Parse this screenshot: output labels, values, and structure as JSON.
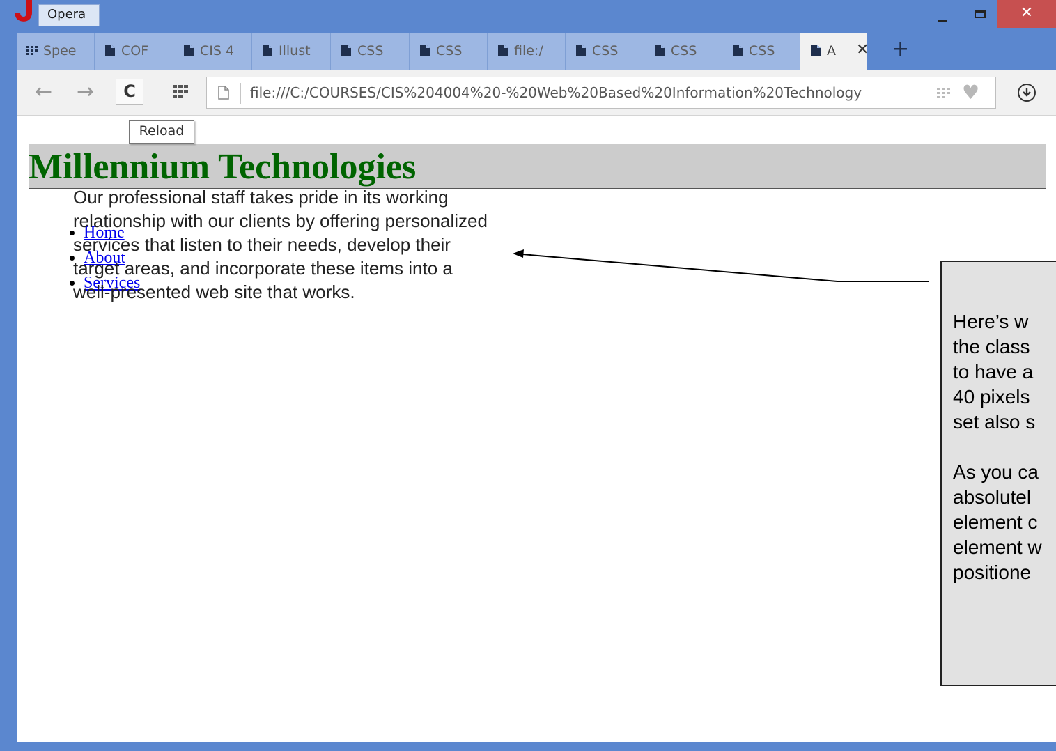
{
  "window": {
    "app_title": "Opera",
    "close_glyph": "✕"
  },
  "tabs": [
    {
      "label": "Spee",
      "icon": "speed-dial-icon"
    },
    {
      "label": "COF",
      "icon": "page-icon"
    },
    {
      "label": "CIS 4",
      "icon": "page-icon"
    },
    {
      "label": "Illust",
      "icon": "page-icon"
    },
    {
      "label": "CSS",
      "icon": "page-icon"
    },
    {
      "label": "CSS",
      "icon": "page-icon"
    },
    {
      "label": "file:/",
      "icon": "page-icon"
    },
    {
      "label": "CSS",
      "icon": "page-icon"
    },
    {
      "label": "CSS",
      "icon": "page-icon"
    },
    {
      "label": "CSS",
      "icon": "page-icon"
    },
    {
      "label": "A",
      "icon": "page-icon",
      "active": true,
      "close_glyph": "✕"
    }
  ],
  "new_tab_glyph": "+",
  "toolbar": {
    "back_glyph": "←",
    "forward_glyph": "→",
    "reload_glyph": "C",
    "address": "file:///C:/COURSES/CIS%204004%20-%20Web%20Based%20Information%20Technology",
    "bookmark_glyph": "♥",
    "reload_tooltip": "Reload"
  },
  "page": {
    "site_title": "Millennium Technologies",
    "nav_links": [
      "Home",
      "About",
      "Services"
    ],
    "content_text": "Our professional staff takes pride in its working relationship with our clients by offering personalized services that listen to their needs, develop their target areas, and incorporate these items into a well-presented web site that works.",
    "callout_text": "Here’s w\nthe class\nto have a\n40 pixels\nset also s\n\nAs you ca\nabsolutel\nelement c\nelement w\npositione"
  },
  "colors": {
    "title_green": "#006400",
    "header_gray": "#cccccc",
    "window_blue": "#5b87cf",
    "close_red": "#c75050",
    "link_blue": "#0000ee"
  }
}
